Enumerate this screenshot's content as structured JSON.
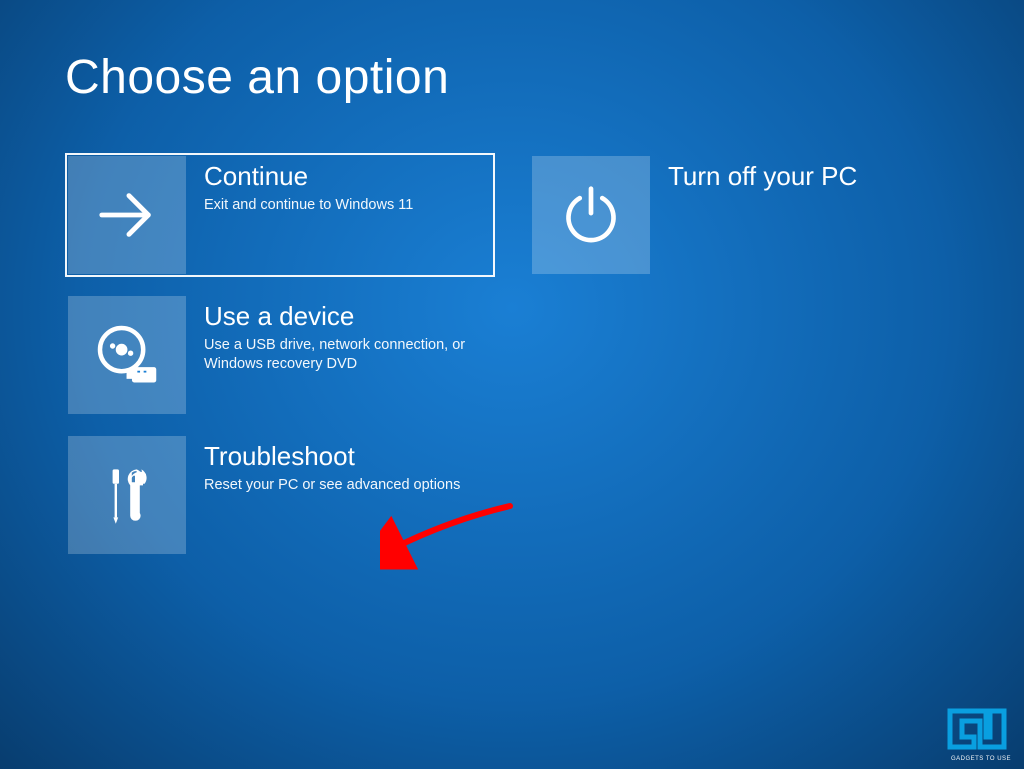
{
  "title": "Choose an option",
  "options": {
    "continue": {
      "title": "Continue",
      "desc": "Exit and continue to Windows 11"
    },
    "turnoff": {
      "title": "Turn off your PC",
      "desc": ""
    },
    "device": {
      "title": "Use a device",
      "desc": "Use a USB drive, network connection, or Windows recovery DVD"
    },
    "troubleshoot": {
      "title": "Troubleshoot",
      "desc": "Reset your PC or see advanced options"
    }
  },
  "watermark": "GADGETS TO USE",
  "colors": {
    "bg_center": "#1a7fd4",
    "bg_edge": "#083d6f",
    "tile": "rgba(255,255,255,0.22)",
    "annotation": "#ff0000"
  }
}
